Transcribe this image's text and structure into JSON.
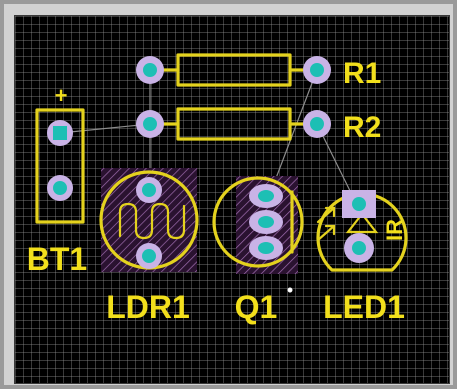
{
  "colors": {
    "board_background": "#000000",
    "grid": "#5a5a5a",
    "silkscreen": "#e4d21e",
    "pad_ring": "#c9b3e6",
    "pad_drill": "#1dbfb4",
    "trace": "#8d8d8d",
    "frame": "#9a9a9a"
  },
  "components": {
    "battery": {
      "designator": "BT1",
      "polarity_mark": "+"
    },
    "resistor_1": {
      "designator": "R1"
    },
    "resistor_2": {
      "designator": "R2"
    },
    "ldr": {
      "designator": "LDR1"
    },
    "transistor": {
      "designator": "Q1",
      "pin1_dot": "•"
    },
    "led": {
      "designator": "LED1",
      "type_text": "IR"
    }
  }
}
